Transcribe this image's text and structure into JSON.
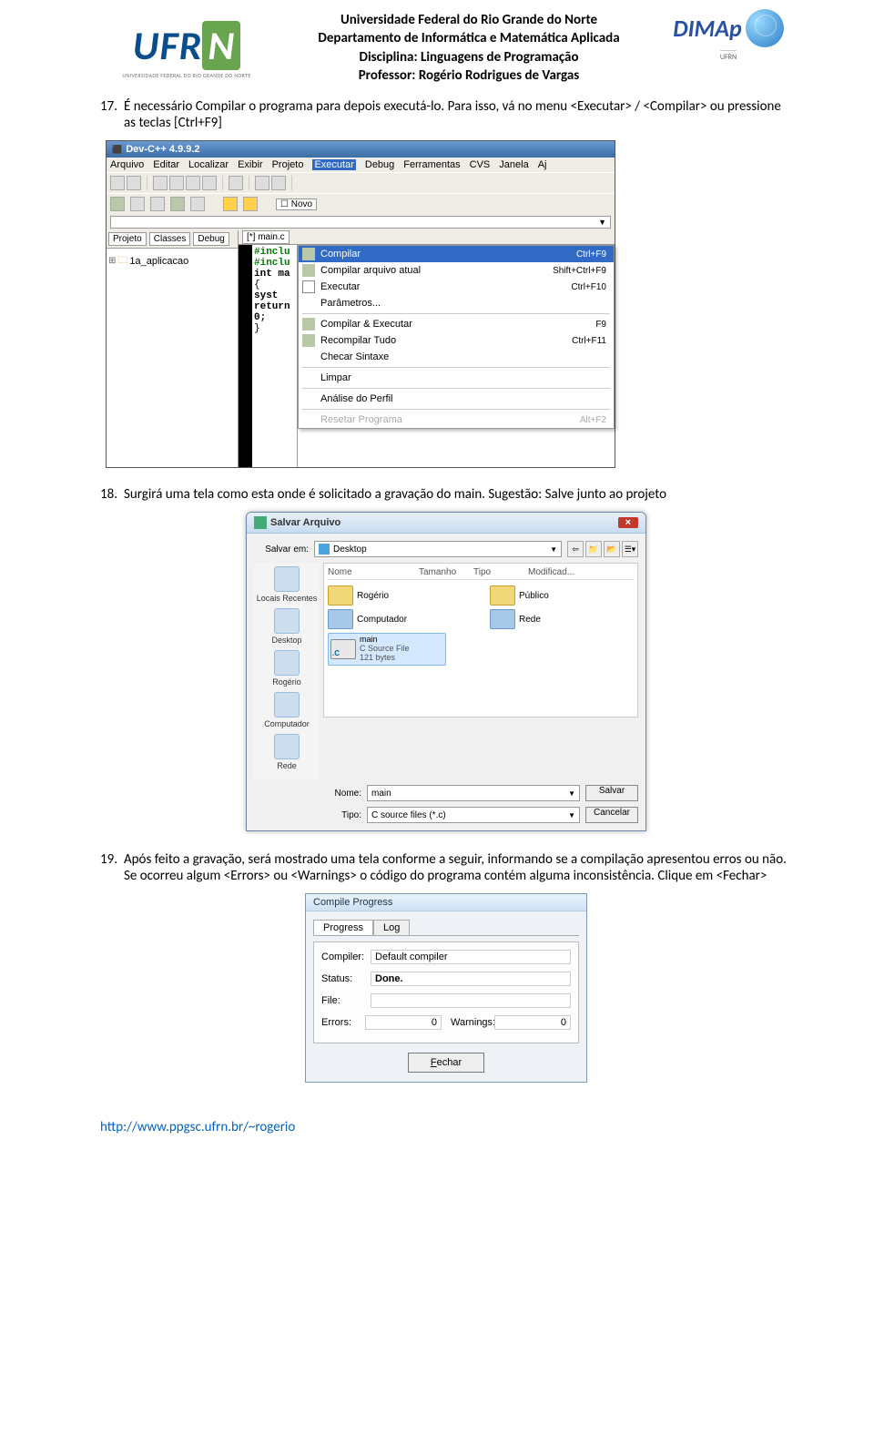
{
  "header": {
    "line1": "Universidade Federal do Rio Grande do Norte",
    "line2": "Departamento de Informática e Matemática Aplicada",
    "line3": "Disciplina: Linguagens de Programação",
    "line4": "Professor: Rogério Rodrigues de Vargas",
    "ufrn_sub": "UNIVERSIDADE FEDERAL DO RIO GRANDE DO NORTE",
    "dimap": "DIMAp",
    "dimap_small": "UFRN"
  },
  "item17": {
    "num": "17.",
    "text": "É necessário Compilar o programa para depois executá-lo. Para isso, vá no menu <Executar> / <Compilar> ou pressione as teclas [Ctrl+F9]"
  },
  "ide": {
    "title": "Dev-C++ 4.9.9.2",
    "menus": [
      "Arquivo",
      "Editar",
      "Localizar",
      "Exibir",
      "Projeto",
      "Executar",
      "Debug",
      "Ferramentas",
      "CVS",
      "Janela",
      "Aj"
    ],
    "novo": "Novo",
    "left_tabs": [
      "Projeto",
      "Classes",
      "Debug"
    ],
    "editor_tab": "[*] main.c",
    "tree_item": "1a_aplicacao",
    "code": {
      "l1": "#inclu",
      "l2": "#inclu",
      "l3": "",
      "l4": "int ma",
      "l5": "{",
      "l6": "",
      "l7": "    syst",
      "l8": "    return 0;",
      "l9": "}"
    },
    "menu_items": [
      {
        "label": "Compilar",
        "shortcut": "Ctrl+F9",
        "hl": true
      },
      {
        "label": "Compilar arquivo atual",
        "shortcut": "Shift+Ctrl+F9"
      },
      {
        "label": "Executar",
        "shortcut": "Ctrl+F10"
      },
      {
        "label": "Parâmetros..."
      },
      {
        "sep": true
      },
      {
        "label": "Compilar & Executar",
        "shortcut": "F9"
      },
      {
        "label": "Recompilar Tudo",
        "shortcut": "Ctrl+F11"
      },
      {
        "label": "Checar Sintaxe"
      },
      {
        "sep": true
      },
      {
        "label": "Limpar"
      },
      {
        "sep": true
      },
      {
        "label": "Análise do Perfil"
      },
      {
        "sep": true
      },
      {
        "label": "Resetar Programa",
        "shortcut": "Alt+F2",
        "dis": true
      }
    ]
  },
  "item18": {
    "num": "18.",
    "text": "Surgirá uma tela como esta onde é solicitado a gravação do main. Sugestão: Salve junto ao projeto"
  },
  "save": {
    "title": "Salvar Arquivo",
    "salvar_em_lbl": "Salvar em:",
    "salvar_em_val": "Desktop",
    "cols": [
      "Nome",
      "Tamanho",
      "Tipo",
      "Modificad..."
    ],
    "side": [
      "Locais Recentes",
      "Desktop",
      "Rogério",
      "Computador",
      "Rede"
    ],
    "files": {
      "rogerio": "Rogério",
      "publico": "Público",
      "computador": "Computador",
      "rede": "Rede",
      "main_name": "main",
      "main_type": "C Source File",
      "main_size": "121 bytes"
    },
    "nome_lbl": "Nome:",
    "nome_val": "main",
    "tipo_lbl": "Tipo:",
    "tipo_val": "C source files (*.c)",
    "btn_save": "Salvar",
    "btn_cancel": "Cancelar"
  },
  "item19": {
    "num": "19.",
    "text": "Após feito a gravação, será mostrado uma tela conforme a seguir, informando se a compilação apresentou erros ou não. Se ocorreu algum <Errors> ou <Warnings> o código do programa contém alguma inconsistência. Clique em <Fechar>"
  },
  "cp": {
    "title": "Compile Progress",
    "tab1": "Progress",
    "tab2": "Log",
    "compiler_lbl": "Compiler:",
    "compiler_val": "Default compiler",
    "status_lbl": "Status:",
    "status_val": "Done.",
    "file_lbl": "File:",
    "file_val": "",
    "errors_lbl": "Errors:",
    "errors_val": "0",
    "warnings_lbl": "Warnings:",
    "warnings_val": "0",
    "close_u": "F",
    "close_rest": "echar"
  },
  "footer": "http://www.ppgsc.ufrn.br/~rogerio"
}
